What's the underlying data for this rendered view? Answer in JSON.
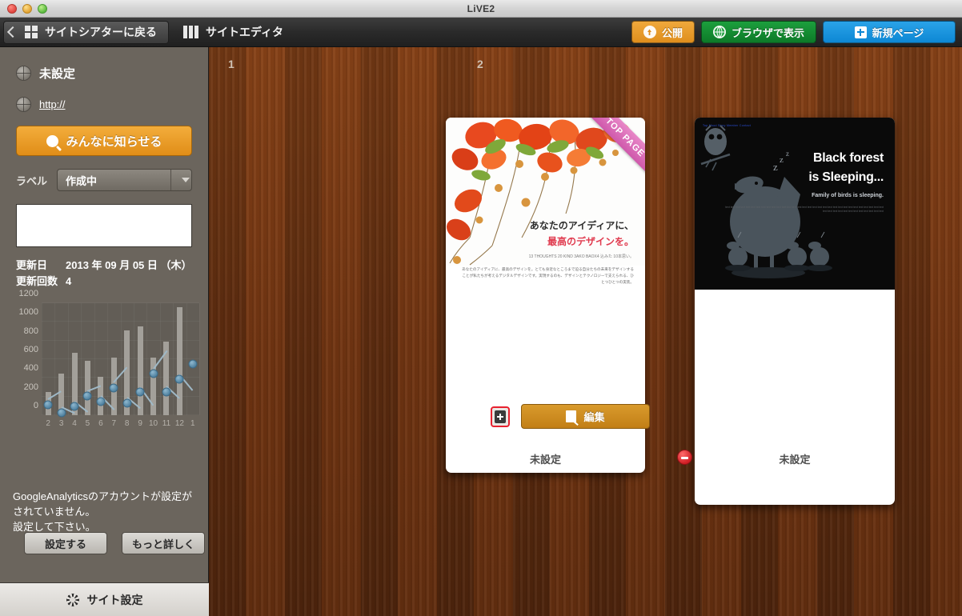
{
  "window": {
    "title": "LiVE2"
  },
  "toolbar": {
    "back_label": "サイトシアターに戻る",
    "editor_label": "サイトエディタ",
    "publish_label": "公開",
    "browser_label": "ブラウザで表示",
    "newpage_label": "新規ページ"
  },
  "sidebar": {
    "site_title": "未設定",
    "site_url": "http://",
    "notify_button": "みんなに知らせる",
    "label_caption": "ラベル",
    "label_value": "作成中",
    "memo_value": "",
    "memo_placeholder": "",
    "updated_key": "更新日",
    "updated_value": "2013 年 09 月 05 日 （木）",
    "count_key": "更新回数",
    "count_value": "4",
    "ga_notice": "GoogleAnalyticsのアカウントが設定がされていません。\n設定して下さい。",
    "ga_setup_button": "設定する",
    "ga_more_button": "もっと詳しく",
    "site_settings_button": "サイト設定"
  },
  "chart_data": {
    "type": "bar",
    "title": "",
    "xlabel": "",
    "ylabel": "",
    "ylim": [
      0,
      1200
    ],
    "yticks": [
      0,
      200,
      400,
      600,
      800,
      1000,
      1200
    ],
    "categories": [
      "2",
      "3",
      "4",
      "5",
      "6",
      "7",
      "8",
      "9",
      "10",
      "11",
      "12",
      "1"
    ],
    "grid": true,
    "legend": "none",
    "series": [
      {
        "name": "bars",
        "type": "bar",
        "values": [
          245,
          450,
          670,
          585,
          415,
          620,
          910,
          950,
          620,
          790,
          1160,
          0
        ]
      },
      {
        "name": "line",
        "type": "line",
        "values": [
          160,
          75,
          140,
          250,
          195,
          340,
          180,
          295,
          490,
          300,
          430,
          600
        ]
      }
    ]
  },
  "pages": [
    {
      "number": "1",
      "caption": "未設定",
      "ribbon": "TOP PAGE",
      "heading1": "あなたのアイディアに、",
      "heading2": "最高のデザインを。",
      "subtext": "13 THOUGHTS 20 KIND 3AKO BAOX4 込みた 10本思い。",
      "body": "あなたのアイディアに、最高のデザインを。とても身近なところまで迫る自分たちの未来をデザインすることが私たちが考えるデジタルデザインです。実現するのも、デザインとテクノロジーで支えられる、ひとつひとつの実装。"
    },
    {
      "number": "2",
      "caption": "未設定",
      "nav": "Top Mood Story Member Contact",
      "heading1": "Black forest",
      "heading2": "is Sleeping...",
      "subtext": "Family of birds is sleeping.",
      "body": "text text text text text text text text text text text text text text text text text text text text text text text text text text text text text text text text text text text text text text text text text text text",
      "edit_button": "編集",
      "add_button": "ページを追加",
      "delete_button": "ページを削除"
    }
  ],
  "colors": {
    "accent_orange": "#e08d18",
    "accent_green": "#0d7a28",
    "accent_blue": "#0d87d4",
    "ribbon_pink": "#cf58ab",
    "delete_red": "#cf1d23",
    "sidebar_bg": "#6b655d",
    "chart_bar": "#a3a09a",
    "chart_point": "#4d7f9e"
  }
}
